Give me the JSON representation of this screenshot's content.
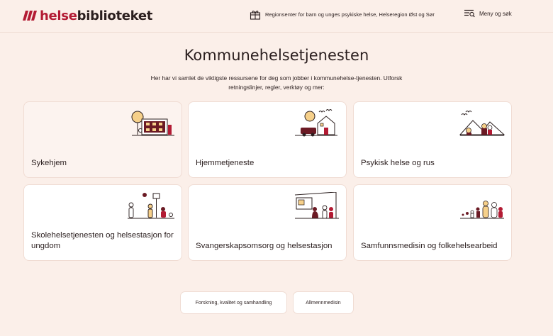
{
  "header": {
    "logo_part1": "helse",
    "logo_part2": "biblioteket",
    "region_label": "Regionsenter for barn og unges psykiske helse, Helseregion Øst og Sør",
    "menu_label": "Meny og søk"
  },
  "page": {
    "title": "Kommunehelsetjenesten",
    "intro": "Her har vi samlet de viktigste ressursene for deg som jobber i kommunehelse-tjenesten. Utforsk retningslinjer, regler, verktøy og mer:"
  },
  "cards": [
    {
      "label": "Sykehjem",
      "icon": "nursing-home-icon"
    },
    {
      "label": "Hjemmetjeneste",
      "icon": "home-care-icon"
    },
    {
      "label": "Psykisk helse og rus",
      "icon": "mental-health-icon"
    },
    {
      "label": "Skolehelsetjenesten og helsestasjon for ungdom",
      "icon": "school-health-icon"
    },
    {
      "label": "Svangerskapsomsorg og helsestasjon",
      "icon": "maternity-care-icon"
    },
    {
      "label": "Samfunnsmedisin og folkehelsearbeid",
      "icon": "public-health-icon"
    }
  ],
  "links": [
    {
      "label": "Forskning, kvalitet og samhandling"
    },
    {
      "label": "Allmennmedisin"
    }
  ],
  "colors": {
    "background": "#fbefe9",
    "brand_red": "#b31b34",
    "dark": "#2b1f1f",
    "illustration_yellow": "#f6d08a",
    "illustration_maroon": "#6b1a24"
  }
}
